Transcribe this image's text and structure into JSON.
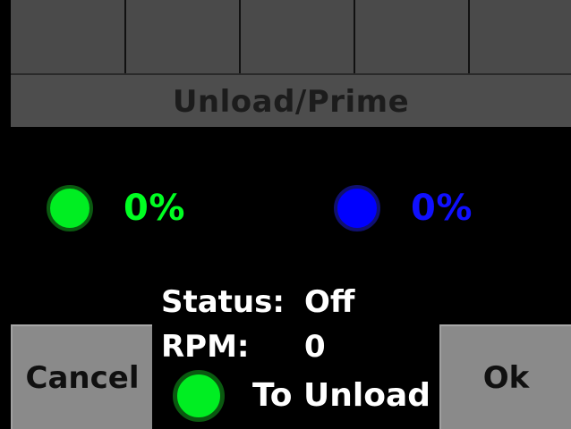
{
  "screen": {
    "title": "Unload/Prime"
  },
  "tabs": [
    "",
    "",
    "",
    "",
    ""
  ],
  "pumps": [
    {
      "indicator_color": "#00ee22",
      "value": "0%"
    },
    {
      "indicator_color": "#0000ff",
      "value": "0%"
    }
  ],
  "status": {
    "status_label": "Status:",
    "status_value": "Off",
    "rpm_label": "RPM:",
    "rpm_value": "0"
  },
  "direction": {
    "indicator_color": "#00ee22",
    "label": "To Unload"
  },
  "buttons": {
    "cancel_label": "Cancel",
    "ok_label": "Ok"
  },
  "colors": {
    "background": "#000000",
    "title_bar": "#4d4d4d",
    "button": "#8a8a8a",
    "green": "#00ff22",
    "blue": "#1010ff"
  }
}
